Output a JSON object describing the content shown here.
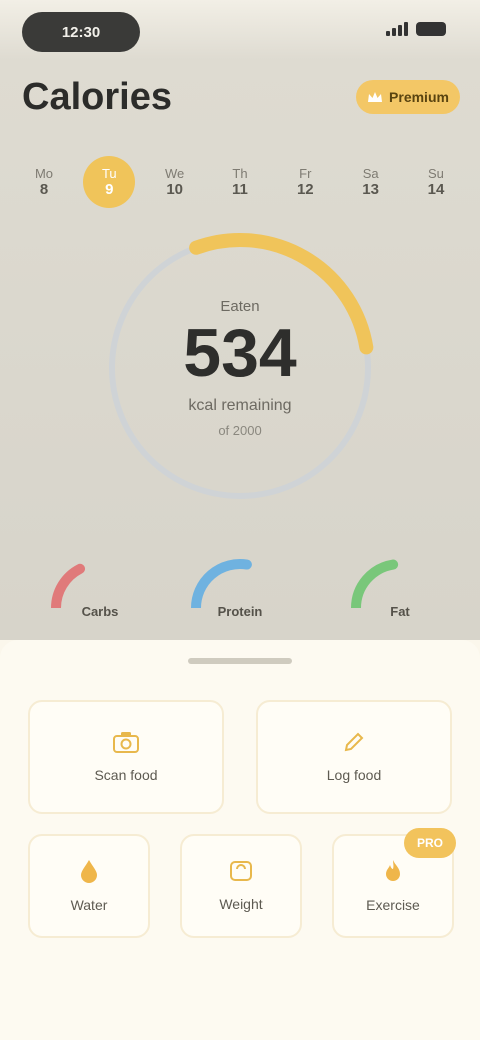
{
  "status_bar": {
    "time": "12:30"
  },
  "header": {
    "title": "Calories",
    "premium_label": "Premium"
  },
  "week": [
    {
      "label": "Mo",
      "num": "8"
    },
    {
      "label": "Tu",
      "num": "9"
    },
    {
      "label": "We",
      "num": "10"
    },
    {
      "label": "Th",
      "num": "11"
    },
    {
      "label": "Fr",
      "num": "12"
    },
    {
      "label": "Sa",
      "num": "13"
    },
    {
      "label": "Su",
      "num": "14"
    }
  ],
  "summary": {
    "label": "Eaten",
    "value": "534",
    "sub": "kcal remaining",
    "goal": "of 2000",
    "progress": 0.28,
    "colors": {
      "accent": "#f0c45a",
      "track": "#cfd3d6"
    }
  },
  "macros": [
    {
      "label": "Carbs",
      "color": "#e07a7a",
      "progress": 0.35
    },
    {
      "label": "Protein",
      "color": "#6fb2e0",
      "progress": 0.55
    },
    {
      "label": "Fat",
      "color": "#79c77a",
      "progress": 0.45
    }
  ],
  "actions": {
    "scan": "Scan food",
    "log": "Log food",
    "water": "Water",
    "weight": "Weight",
    "exercise": "Exercise",
    "pro": "PRO"
  }
}
